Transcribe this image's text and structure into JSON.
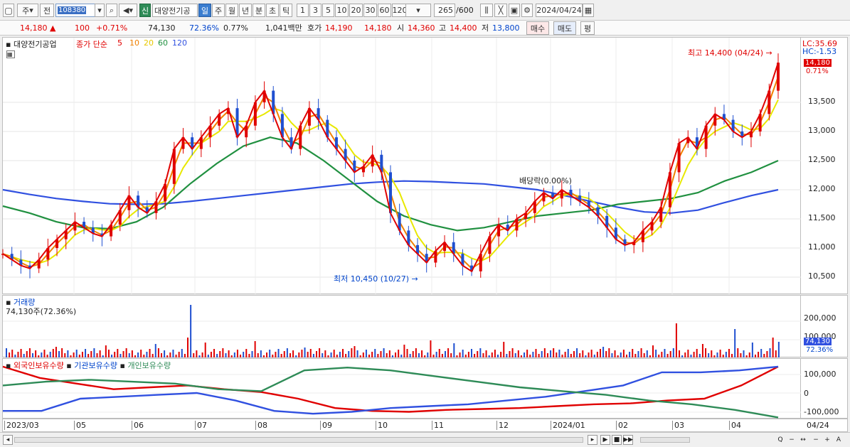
{
  "toolbar": {
    "type1": "주",
    "type2": "전",
    "code": "108380",
    "new_badge": "신",
    "stock_name": "대양전기공",
    "periods": [
      "일",
      "주",
      "월",
      "년",
      "분",
      "초",
      "틱"
    ],
    "active_period": "일",
    "minutes": [
      "1",
      "3",
      "5",
      "10",
      "20",
      "30",
      "60",
      "120"
    ],
    "count": "265",
    "count_total": "/600",
    "date": "2024/04/24"
  },
  "quote": {
    "price": "14,180",
    "arrow": "▲",
    "change": "100",
    "change_pct": "+0.71%",
    "volume": "74,130",
    "vol_ratio": "72.36%",
    "turnover_pct": "0.77%",
    "amount": "1,041백만",
    "bid_label": "호가",
    "bid1": "14,190",
    "bid2": "14,180",
    "open_label": "시",
    "open": "14,360",
    "high_label": "고",
    "high": "14,400",
    "low_label": "저",
    "low": "13,800",
    "buy": "매수",
    "sell": "매도",
    "eval": "평"
  },
  "price_panel": {
    "title": "대양전기공업",
    "ma_label": "종가 단순",
    "ma_periods": [
      "5",
      "10",
      "20",
      "60",
      "120"
    ],
    "ma_colors": [
      "#e00000",
      "#f08000",
      "#e8c800",
      "#209040",
      "#3050e0"
    ],
    "high_annot": "최고 14,400 (04/24)",
    "low_annot": "최저 10,450 (10/27)",
    "div_annot": "배당락(0.00%)",
    "lc": "LC:35.69",
    "hc": "HC:-1.53",
    "cur_tag": "14,180",
    "cur_pct": "0.71%",
    "y_ticks": [
      "13,500",
      "13,000",
      "12,500",
      "12,000",
      "11,500",
      "11,000",
      "10,500"
    ]
  },
  "volume_panel": {
    "title": "거래량",
    "value": "74,130주(72.36%)",
    "y_ticks": [
      "200,000",
      "100,000"
    ],
    "cur_tag": "74,130",
    "cur_pct": "72.36%"
  },
  "holders_panel": {
    "labels": [
      "외국인보유수량",
      "기관보유수량",
      "개인보유수량"
    ],
    "colors": [
      "#e00000",
      "#3050e0",
      "#2e8b57"
    ],
    "y_ticks": [
      "100,000",
      "0",
      "-100,000"
    ]
  },
  "x_axis": [
    "2023/03",
    "05",
    "06",
    "07",
    "08",
    "09",
    "10",
    "11",
    "12",
    "2024/01",
    "02",
    "03",
    "04"
  ],
  "x_axis_right": "04/24",
  "chart_data": {
    "type": "line",
    "candles_close": [
      10900,
      10800,
      10700,
      10650,
      10800,
      11000,
      11150,
      11300,
      11450,
      11350,
      11250,
      11200,
      11400,
      11650,
      11900,
      11700,
      11600,
      11800,
      12100,
      12700,
      12900,
      12700,
      12900,
      13100,
      13300,
      13400,
      12900,
      13100,
      13500,
      13700,
      13300,
      12900,
      12700,
      13100,
      13400,
      13200,
      12900,
      12700,
      12500,
      12300,
      12400,
      12600,
      12300,
      11600,
      11300,
      11050,
      10900,
      10750,
      10950,
      11100,
      10900,
      10700,
      10600,
      10900,
      11200,
      11400,
      11300,
      11500,
      11600,
      11800,
      11950,
      11850,
      12000,
      11900,
      11800,
      11700,
      11550,
      11350,
      11150,
      11050,
      11100,
      11300,
      11450,
      11700,
      12300,
      12800,
      12900,
      12700,
      13100,
      13300,
      13200,
      13000,
      12900,
      13000,
      13300,
      13700,
      14180
    ],
    "ma120": [
      12000,
      11920,
      11850,
      11800,
      11760,
      11750,
      11760,
      11800,
      11850,
      11900,
      11950,
      12000,
      12050,
      12100,
      12130,
      12150,
      12140,
      12120,
      12100,
      12050,
      12000,
      11900,
      11800,
      11700,
      11620,
      11600,
      11650,
      11780,
      11900,
      12000
    ],
    "ma60": [
      11720,
      11600,
      11450,
      11350,
      11330,
      11450,
      11700,
      12100,
      12450,
      12750,
      12900,
      12800,
      12500,
      12150,
      11800,
      11550,
      11400,
      11300,
      11350,
      11450,
      11550,
      11600,
      11650,
      11750,
      11800,
      11850,
      11950,
      12150,
      12300,
      12500
    ],
    "foreign": [
      140000,
      80000,
      50000,
      20000,
      30000,
      40000,
      20000,
      5000,
      -30000,
      -80000,
      -95000,
      -100000,
      -90000,
      -85000,
      -80000,
      -70000,
      -60000,
      -55000,
      -40000,
      -30000,
      40000,
      140000
    ],
    "institution": [
      -95000,
      -95000,
      -30000,
      -20000,
      -10000,
      0,
      -40000,
      -95000,
      -110000,
      -100000,
      -80000,
      -70000,
      -60000,
      -40000,
      -20000,
      10000,
      40000,
      110000,
      110000,
      120000,
      140000
    ],
    "individual": [
      40000,
      60000,
      70000,
      60000,
      50000,
      20000,
      10000,
      120000,
      135000,
      120000,
      90000,
      60000,
      30000,
      10000,
      -10000,
      -40000,
      -60000,
      -90000,
      -130000
    ]
  }
}
